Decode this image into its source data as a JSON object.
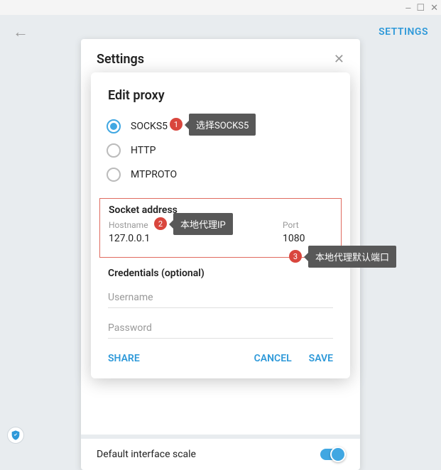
{
  "window": {
    "min": "–",
    "max": "☐",
    "close": "✕"
  },
  "topbar": {
    "back": "←",
    "settings_link": "SETTINGS"
  },
  "settings_panel": {
    "title": "Settings",
    "close": "✕",
    "scale_label": "Default interface scale"
  },
  "modal": {
    "title": "Edit proxy",
    "radios": {
      "socks5": "SOCKS5",
      "http": "HTTP",
      "mtproto": "MTPROTO"
    },
    "socket": {
      "title": "Socket address",
      "hostname_label": "Hostname",
      "hostname_value": "127.0.0.1",
      "port_label": "Port",
      "port_value": "1080"
    },
    "credentials": {
      "title": "Credentials (optional)",
      "username_ph": "Username",
      "password_ph": "Password"
    },
    "actions": {
      "share": "SHARE",
      "cancel": "CANCEL",
      "save": "SAVE"
    }
  },
  "annotations": {
    "n1": "1",
    "t1": "选择SOCKS5",
    "n2": "2",
    "t2": "本地代理IP",
    "n3": "3",
    "t3": "本地代理默认端口"
  }
}
